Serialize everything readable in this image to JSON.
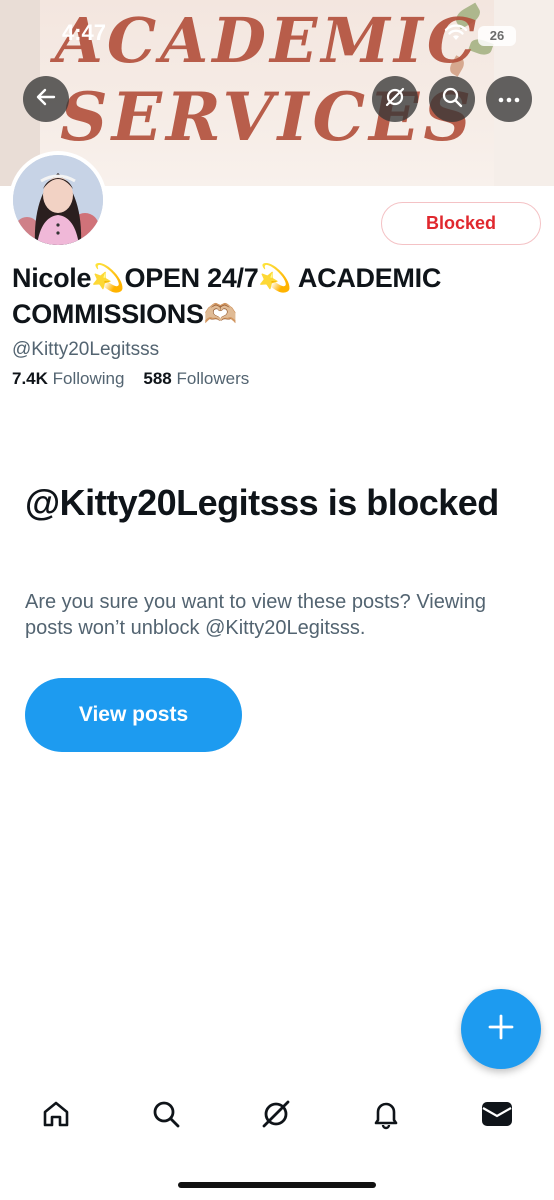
{
  "status_bar": {
    "time": "4:47",
    "battery": "26"
  },
  "banner": {
    "line1": "ACADEMIC",
    "line2": "SERVICES"
  },
  "profile": {
    "blocked_label": "Blocked",
    "name_line1": "Nicole💫OPEN 24/7💫 ACADEMIC",
    "name_line2": "COMMISSIONS🫶🏼",
    "handle": "@Kitty20Legitsss",
    "following_count": "7.4K",
    "following_label": "Following",
    "followers_count": "588",
    "followers_label": "Followers"
  },
  "blocked_notice": {
    "title": "@Kitty20Legitsss is blocked",
    "description": "Are you sure you want to view these posts? Viewing posts won’t unblock @Kitty20Legitsss.",
    "button_label": "View posts"
  },
  "icons": {
    "back": "back-arrow-icon",
    "grok": "grok-icon",
    "search": "search-icon",
    "more": "more-icon",
    "compose": "plus-icon",
    "tabs": [
      "home-icon",
      "search-icon",
      "grok-icon",
      "bell-icon",
      "mail-icon"
    ]
  },
  "colors": {
    "accent": "#1d9bf0",
    "blocked": "#e0282e",
    "secondary_text": "#536471"
  }
}
